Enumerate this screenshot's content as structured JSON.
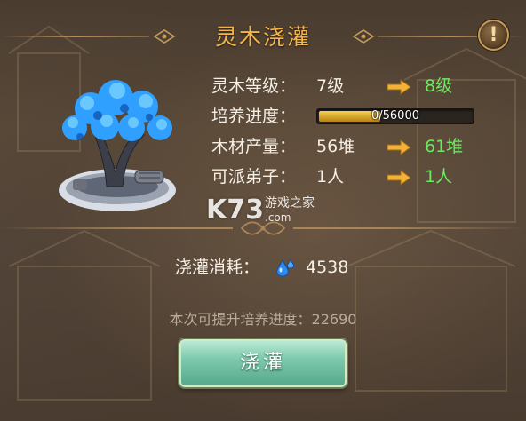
{
  "title": "灵木浇灌",
  "info_button": "!",
  "stats": {
    "level": {
      "label": "灵木等级：",
      "current": "7级",
      "next": "8级"
    },
    "progress": {
      "label": "培养进度：",
      "text": "0/56000",
      "fill_fraction": 0.4
    },
    "wood": {
      "label": "木材产量：",
      "current": "56堆",
      "next": "61堆"
    },
    "disciples": {
      "label": "可派弟子：",
      "current": "1人",
      "next": "1人"
    }
  },
  "cost": {
    "label": "浇灌消耗：",
    "icon": "water-drop-icon",
    "value": "4538"
  },
  "boost": {
    "text": "本次可提升培养进度：22690"
  },
  "button": {
    "label": "浇灌"
  },
  "watermark": {
    "logo": "K73",
    "sub": "游戏之家",
    "domain": ".com"
  },
  "colors": {
    "title": "#f2b54c",
    "next_value": "#6fe860",
    "button": "#7ec9ad",
    "progress": "#e2b23a"
  }
}
